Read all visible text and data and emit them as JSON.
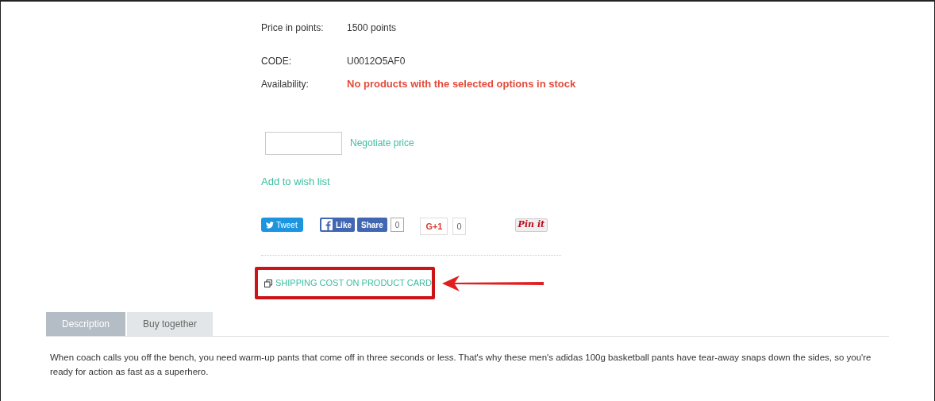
{
  "details": [
    {
      "label": "Price in points:",
      "value": "1500 points",
      "kind": "plain"
    },
    {
      "label": "CODE:",
      "value": "U0012O5AF0",
      "kind": "plain"
    },
    {
      "label": "Availability:",
      "value": "No products with the selected options in stock",
      "kind": "alert"
    }
  ],
  "negotiate_link": "Negotiate price",
  "wishlist_link": "Add to wish list",
  "social": {
    "tweet": "Tweet",
    "like": "Like",
    "share": "Share",
    "share_count": "0",
    "gplus": "G+1",
    "gplus_count": "0",
    "pin": "Pin it"
  },
  "shipping_link": "SHIPPING COST ON PRODUCT CARD",
  "tabs": [
    {
      "label": "Description",
      "selected": true
    },
    {
      "label": "Buy together",
      "selected": false
    }
  ],
  "description": "When coach calls you off the bench, you need warm-up pants that come off in three seconds or less. That's why these men's adidas 100g basketball pants have tear-away snaps down the sides, so you're ready for action as fast as a superhero."
}
